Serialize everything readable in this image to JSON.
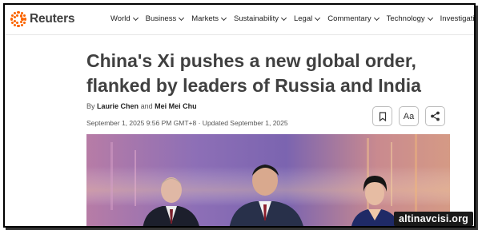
{
  "brand": {
    "name": "Reuters",
    "accent": "#fa6400"
  },
  "nav": {
    "items": [
      {
        "label": "World",
        "icon": "chevron-down-icon"
      },
      {
        "label": "Business",
        "icon": "chevron-down-icon"
      },
      {
        "label": "Markets",
        "icon": "chevron-down-icon"
      },
      {
        "label": "Sustainability",
        "icon": "chevron-down-icon"
      },
      {
        "label": "Legal",
        "icon": "chevron-down-icon"
      },
      {
        "label": "Commentary",
        "icon": "chevron-down-icon"
      },
      {
        "label": "Technology",
        "icon": "chevron-down-icon"
      },
      {
        "label": "Investigations",
        "icon": ""
      }
    ]
  },
  "article": {
    "headline": "China's Xi pushes a new global order, flanked by leaders of Russia and India",
    "by_prefix": "By",
    "author1": "Laurie Chen",
    "and": "and",
    "author2": "Mei Mei Chu",
    "dateline": "September 1, 2025 9:56 PM GMT+8 · Updated September 1, 2025"
  },
  "tools": {
    "bookmark_icon": "bookmark-icon",
    "text_size_label": "Aa",
    "share_icon": "share-icon"
  },
  "photo": {
    "description_icon": "news-photo"
  },
  "watermark": {
    "text": "altinavcisi.org"
  }
}
